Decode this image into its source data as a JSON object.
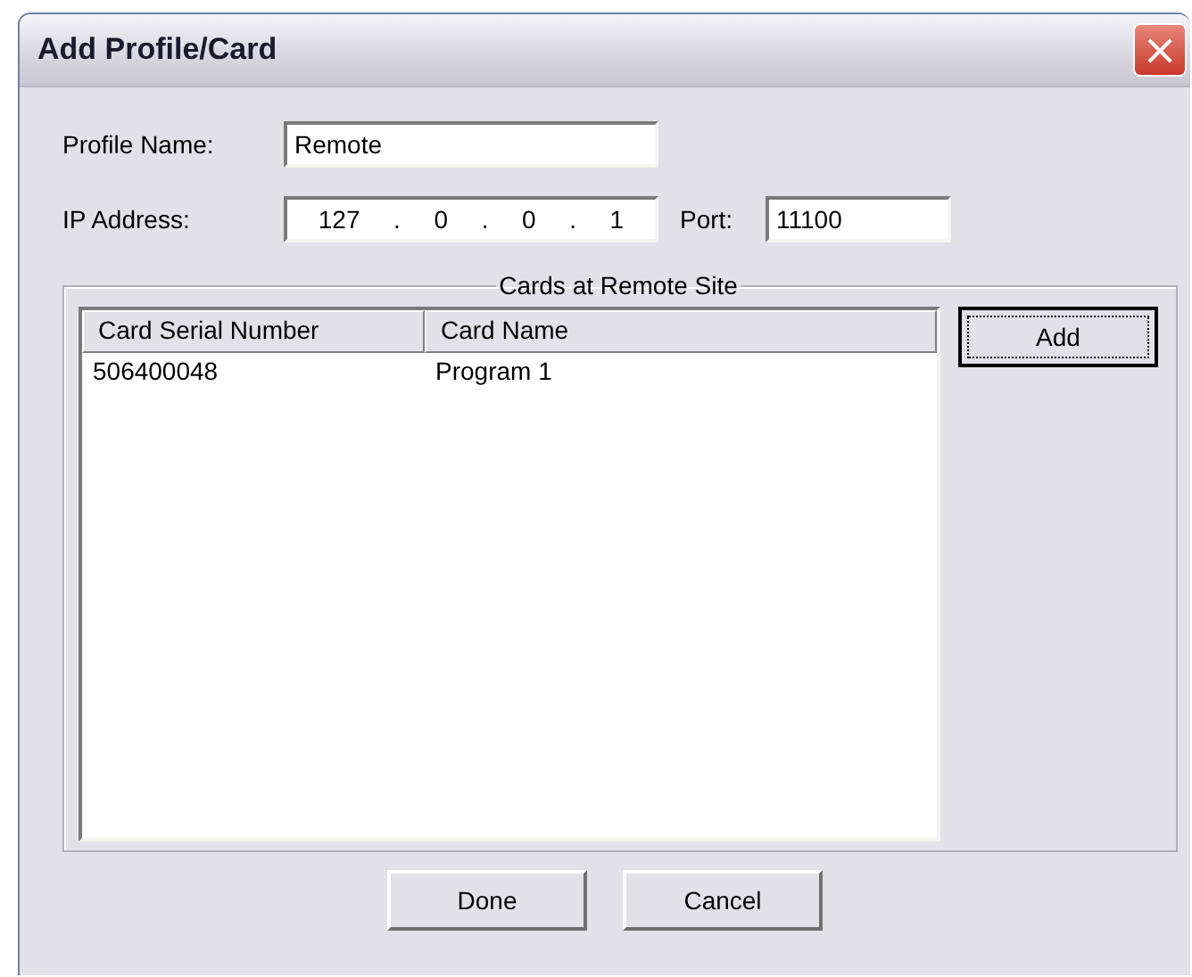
{
  "window": {
    "title": "Add Profile/Card",
    "close": "×"
  },
  "profile_name": {
    "label": "Profile Name:",
    "value": "Remote"
  },
  "ip_address": {
    "label": "IP Address:",
    "octets": [
      "127",
      "0",
      "0",
      "1"
    ],
    "separator": "."
  },
  "port": {
    "label": "Port:",
    "value": "11100"
  },
  "group": {
    "title": "Cards at Remote Site"
  },
  "table": {
    "columns": [
      "Card Serial Number",
      "Card Name"
    ],
    "rows": [
      [
        "506400048",
        "Program 1"
      ]
    ]
  },
  "side_button": {
    "label": "Add",
    "focused": true
  },
  "buttons": [
    "Done",
    "Cancel"
  ]
}
